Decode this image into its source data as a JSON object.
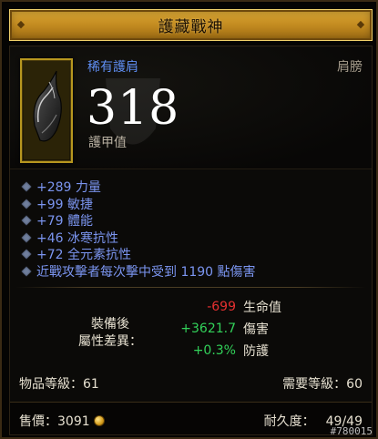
{
  "title": "護藏戰神",
  "item": {
    "rarity": "稀有護肩",
    "slot": "肩膀",
    "armor_value": "318",
    "armor_label": "護甲值",
    "icon": "shoulder-armor-icon"
  },
  "affixes": [
    "+289 力量",
    "+99 敏捷",
    "+79 體能",
    "+46 冰寒抗性",
    "+72 全元素抗性",
    "近戰攻擊者每次擊中受到 1190 點傷害"
  ],
  "compare": {
    "label_line1": "裝備後",
    "label_line2": "屬性差異：",
    "rows": [
      {
        "value": "-699",
        "name": "生命值",
        "color": "#e53030"
      },
      {
        "value": "+3621.7",
        "name": "傷害",
        "color": "#32d25a"
      },
      {
        "value": "+0.3%",
        "name": "防護",
        "color": "#32d25a"
      }
    ]
  },
  "item_level": "物品等級：61",
  "required_level": "需要等級：60",
  "footer": {
    "sell_label": "售價：3091",
    "gold_icon": "gold-coin-icon",
    "durability_label": "耐久度：",
    "durability_value": "49/49"
  },
  "watermark": "#780015",
  "colors": {
    "rare_blue": "#5f8ef2",
    "affix_blue": "#7b95f0",
    "gold_border": "#b7971f",
    "title_gold": "#c68e22"
  }
}
